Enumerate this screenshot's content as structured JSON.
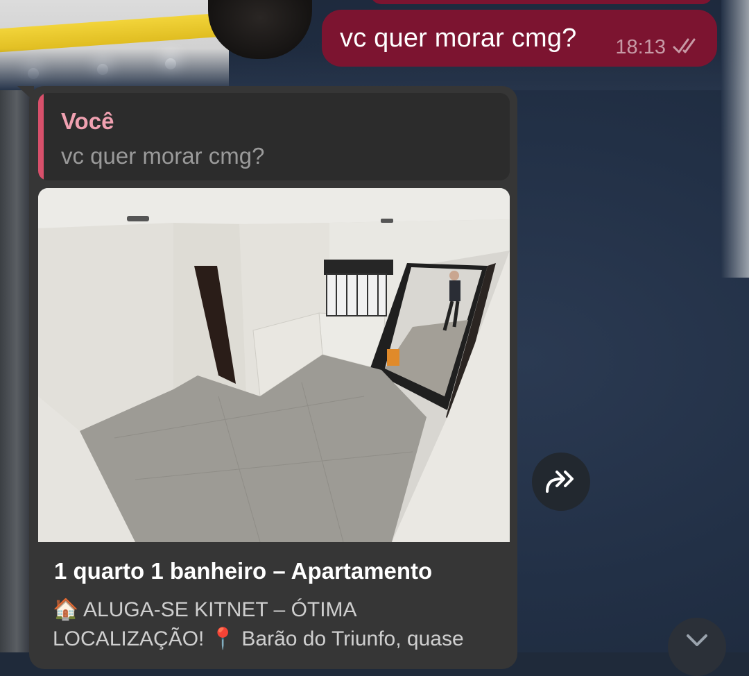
{
  "outgoing_message": {
    "text": "vc quer morar cmg?",
    "time": "18:13",
    "status_icon": "double-check-icon",
    "bubble_color": "#7c1430"
  },
  "incoming_message": {
    "bubble_color": "#363636",
    "reply": {
      "sender": "Você",
      "text": "vc quer morar cmg?",
      "accent_color": "#d8506b"
    },
    "link_preview": {
      "title": "1 quarto 1 banheiro – Apartamento",
      "description": "🏠 ALUGA-SE KITNET – ÓTIMA LOCALIZAÇÃO! 📍 Barão do Triunfo, quase"
    }
  },
  "icons": {
    "forward": "forward-arrow-icon",
    "scroll_down": "chevron-down-icon"
  }
}
